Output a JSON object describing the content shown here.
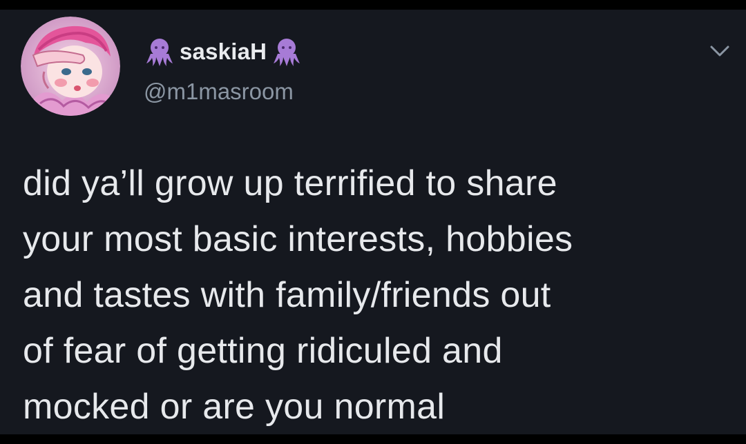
{
  "tweet": {
    "display_name": "saskiaH",
    "handle": "@m1masroom",
    "text": "did ya’ll grow up terrified to share\nyour most basic interests, hobbies\nand tastes with family/friends out\nof fear of getting ridiculed and\nmocked or are you normal",
    "name_emoji_icon": "octopus-icon",
    "menu_icon": "chevron-down-icon"
  },
  "colors": {
    "background": "#15181f",
    "text": "#e7e9ec",
    "handle": "#8b96a3",
    "octopus": "#a77bd6"
  }
}
